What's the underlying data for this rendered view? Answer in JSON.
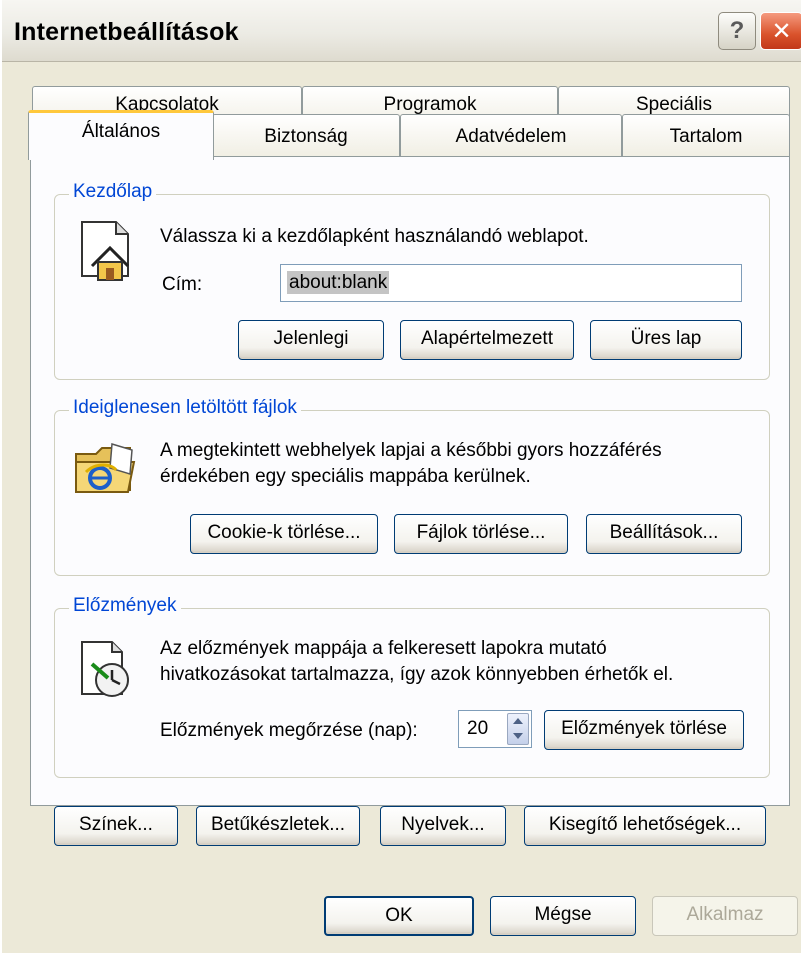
{
  "window": {
    "title": "Internetbeállítások"
  },
  "titlebar": {
    "help_label": "?",
    "close_label": "✕"
  },
  "tabs": {
    "row1": [
      "Kapcsolatok",
      "Programok",
      "Speciális"
    ],
    "row2": [
      "Általános",
      "Biztonság",
      "Adatvédelem",
      "Tartalom"
    ],
    "active": "Általános"
  },
  "home": {
    "legend": "Kezdőlap",
    "description": "Válassza ki a kezdőlapként használandó weblapot.",
    "address_label": "Cím:",
    "address_value": "about:blank",
    "buttons": [
      "Jelenlegi",
      "Alapértelmezett",
      "Üres lap"
    ]
  },
  "temp_files": {
    "legend": "Ideiglenesen letöltött fájlok",
    "line1": "A megtekintett webhelyek lapjai a későbbi gyors hozzáférés",
    "line2": "érdekében egy speciális mappába kerülnek.",
    "buttons": [
      "Cookie-k törlése...",
      "Fájlok törlése...",
      "Beállítások..."
    ]
  },
  "history": {
    "legend": "Előzmények",
    "line1": "Az előzmények mappája a felkeresett lapokra mutató",
    "line2": "hivatkozásokat tartalmazza, így azok könnyebben érhetők el.",
    "days_label": "Előzmények megőrzése (nap):",
    "days_value": "20",
    "clear_button": "Előzmények törlése"
  },
  "bottom_buttons": [
    "Színek...",
    "Betűkészletek...",
    "Nyelvek...",
    "Kisegítő lehetőségek..."
  ],
  "dialog_buttons": {
    "ok": "OK",
    "cancel": "Mégse",
    "apply": "Alkalmaz"
  },
  "colors": {
    "legend": "#0046d5",
    "tab_highlight": "#ffc83c",
    "close": "#d9522b"
  }
}
